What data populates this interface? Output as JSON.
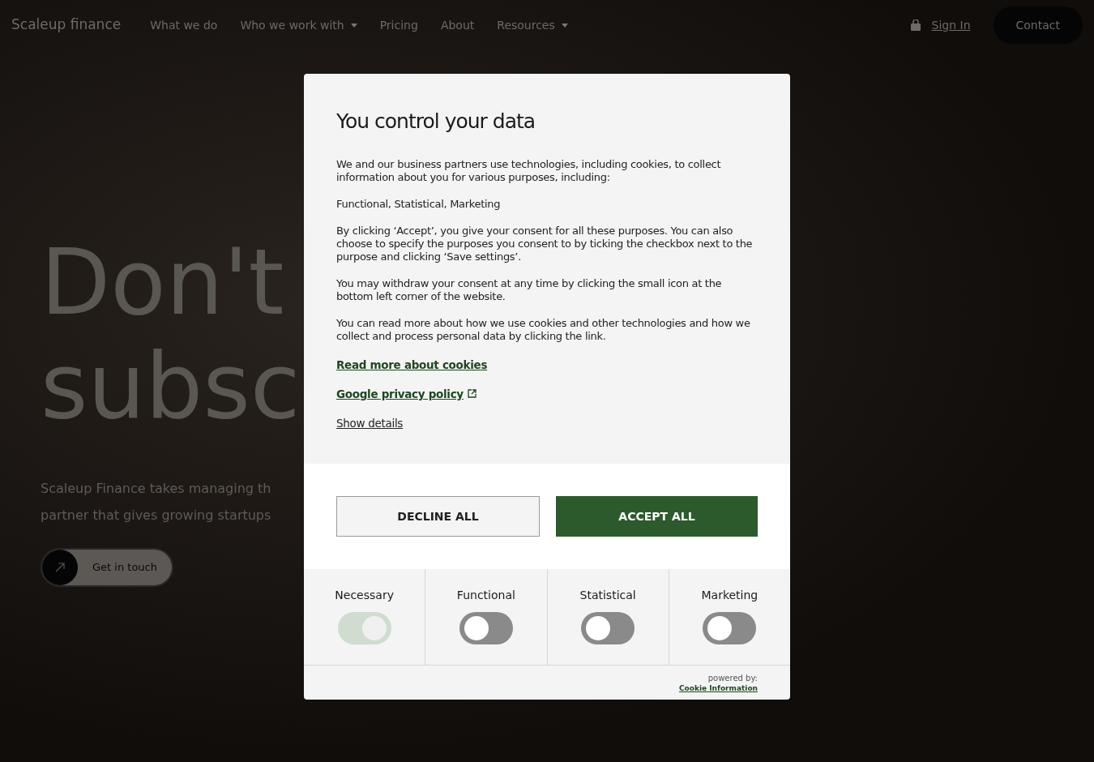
{
  "nav": {
    "logo": "Scaleup finance",
    "items": [
      {
        "label": "What we do",
        "dropdown": false
      },
      {
        "label": "Who we work with",
        "dropdown": true
      },
      {
        "label": "Pricing",
        "dropdown": false
      },
      {
        "label": "About",
        "dropdown": false
      },
      {
        "label": "Resources",
        "dropdown": true
      }
    ],
    "sign_in": "Sign In",
    "contact": "Contact"
  },
  "hero": {
    "headline": [
      "Don't",
      "subsc"
    ],
    "lines": [
      "Scaleup Finance takes managing th",
      "partner that gives growing startups"
    ],
    "cta": "Get in touch"
  },
  "consent": {
    "title": "You control your data",
    "paragraphs": [
      "We and our business partners use technologies, including cookies, to collect information about you for various purposes, including:",
      "Functional, Statistical, Marketing",
      "By clicking ‘Accept’, you give your consent for all these purposes. You can also choose to specify the purposes you consent to by ticking the checkbox next to the purpose and clicking ‘Save settings’.",
      "You may withdraw your consent at any time by clicking the small icon at the bottom left corner of the website.",
      "You can read more about how we use cookies and other technologies and how we collect and process personal data by clicking the link."
    ],
    "links": [
      {
        "label": "Read more about cookies",
        "external": false
      },
      {
        "label": "Google privacy policy",
        "external": true
      }
    ],
    "show_details": "Show details",
    "decline": "DECLINE ALL",
    "accept": "ACCEPT ALL",
    "categories": [
      {
        "label": "Necessary",
        "on": true,
        "disabled": true
      },
      {
        "label": "Functional",
        "on": false,
        "disabled": false
      },
      {
        "label": "Statistical",
        "on": false,
        "disabled": false
      },
      {
        "label": "Marketing",
        "on": false,
        "disabled": false
      }
    ],
    "powered_by": "powered by:",
    "provider": "Cookie Information"
  }
}
